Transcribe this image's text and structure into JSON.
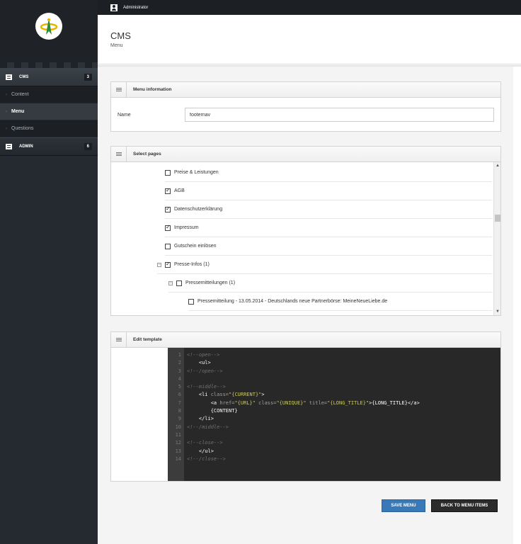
{
  "topbar": {
    "user": "Administrator"
  },
  "header": {
    "title": "CMS",
    "subtitle": "Menu"
  },
  "sidebar": {
    "groups": [
      {
        "label": "CMS",
        "count": "3",
        "items": [
          "Content",
          "Menu",
          "Questions"
        ],
        "active": "Menu"
      },
      {
        "label": "ADMIN",
        "count": "6"
      }
    ]
  },
  "menu_info": {
    "title": "Menu information",
    "name_label": "Name",
    "name_value": "footernav"
  },
  "select_pages": {
    "title": "Select pages",
    "items": [
      {
        "label": "Preise & Leistungen",
        "checked": false,
        "level": 0
      },
      {
        "label": "AGB",
        "checked": true,
        "level": 0
      },
      {
        "label": "Datenschutzerklärung",
        "checked": true,
        "level": 0
      },
      {
        "label": "Impressum",
        "checked": true,
        "level": 0
      },
      {
        "label": "Gutschein einlösen",
        "checked": false,
        "level": 0
      },
      {
        "label": "Presse-Infos (1)",
        "checked": true,
        "level": 0,
        "expander": "−"
      },
      {
        "label": "Pressemitteilungen (1)",
        "checked": false,
        "level": 1,
        "expander": "−"
      },
      {
        "label": "Pressemitteilung - 13.05.2014 - Deutschlands neue Partnerbörse: MeineNeueLiebe.de",
        "checked": false,
        "level": 2
      }
    ]
  },
  "edit_template": {
    "title": "Edit template",
    "line_numbers": [
      "1",
      "2",
      "3",
      "4",
      "5",
      "6",
      "7",
      "8",
      "9",
      "10",
      "11",
      "12",
      "13",
      "14"
    ]
  },
  "buttons": {
    "save": "SAVE MENU",
    "back": "BACK TO MENU ITEMS"
  }
}
